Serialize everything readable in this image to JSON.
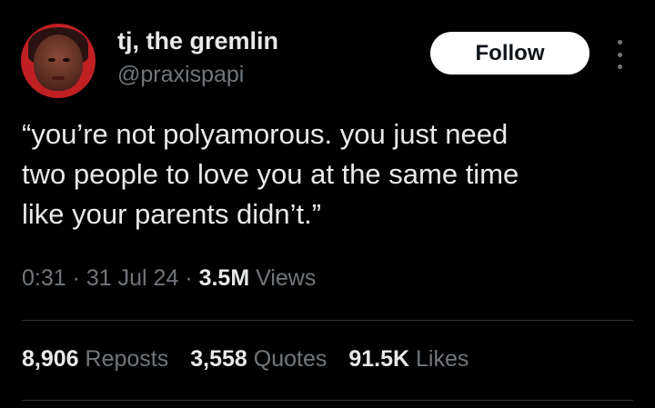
{
  "author": {
    "display_name": "tj, the gremlin",
    "handle": "@praxispapi",
    "avatar_icon": "profile-photo"
  },
  "actions": {
    "follow_label": "Follow",
    "more_icon": "more-vertical-icon"
  },
  "tweet": {
    "text": "“you’re not polyamorous. you just need\ntwo people to love you at the same time\nlike your parents didn’t.”"
  },
  "meta": {
    "time": "0:31",
    "sep1": " · ",
    "date": "31 Jul 24",
    "sep2": " · ",
    "views_count": "3.5M",
    "views_label": " Views"
  },
  "stats": {
    "reposts_count": "8,906",
    "reposts_label": " Reposts",
    "quotes_count": "3,558",
    "quotes_label": " Quotes",
    "likes_count": "91.5K",
    "likes_label": " Likes"
  },
  "colors": {
    "background": "#000000",
    "primary_text": "#e7e9ea",
    "secondary_text": "#71767b",
    "button_bg": "#ffffff",
    "avatar_ring": "#c01f24"
  }
}
